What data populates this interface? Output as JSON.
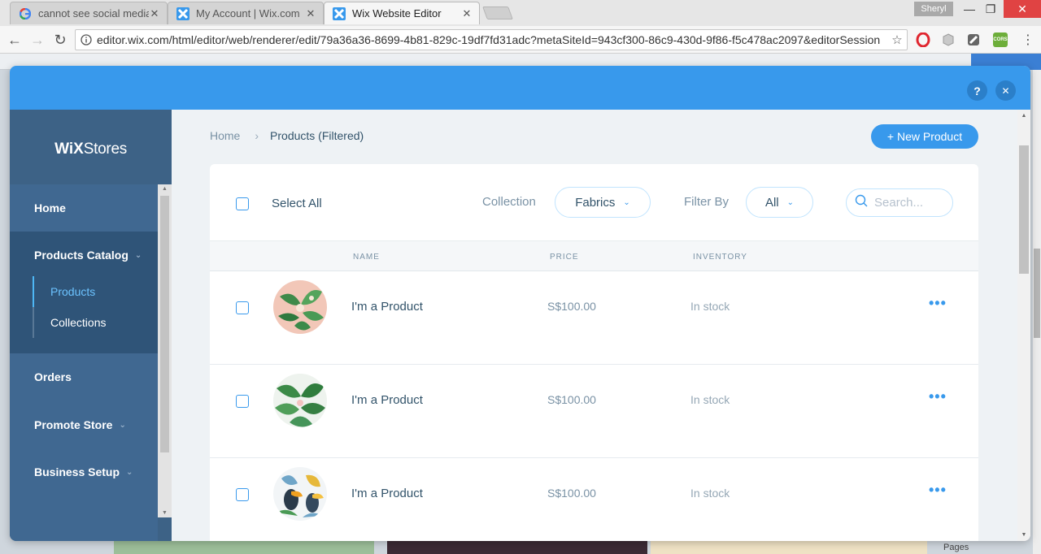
{
  "browser": {
    "tabs": [
      {
        "title": "cannot see social media",
        "favicon": "google-icon"
      },
      {
        "title": "My Account | Wix.com",
        "favicon": "wix-icon"
      },
      {
        "title": "Wix Website Editor",
        "favicon": "wix-icon",
        "active": true
      }
    ],
    "close_glyph": "✕",
    "profile_name": "Sheryl",
    "url": "editor.wix.com/html/editor/web/renderer/edit/79a36a36-8699-4b81-829c-19df7fd31adc?metaSiteId=943cf300-86c9-430d-9f86-f5c478ac2097&editorSession",
    "ext_cors_label": "CORS"
  },
  "modal": {
    "help_glyph": "?",
    "close_glyph": "✕"
  },
  "sidebar": {
    "logo_bold": "WiX",
    "logo_rest": "Stores",
    "items": [
      {
        "label": "Home"
      },
      {
        "label": "Products Catalog"
      },
      {
        "label": "Orders"
      },
      {
        "label": "Promote Store"
      },
      {
        "label": "Business Setup"
      }
    ],
    "sub_items": [
      {
        "label": "Products",
        "active": true
      },
      {
        "label": "Collections"
      }
    ]
  },
  "content": {
    "breadcrumb": {
      "home": "Home",
      "current": "Products (Filtered)"
    },
    "new_product_label": "+ New Product",
    "select_all_label": "Select All",
    "collection_label": "Collection",
    "collection_value": "Fabrics",
    "filter_label": "Filter By",
    "filter_value": "All",
    "search_placeholder": "Search...",
    "columns": [
      "NAME",
      "PRICE",
      "INVENTORY"
    ],
    "rows": [
      {
        "name": "I'm a Product",
        "price": "S$100.00",
        "inventory": "In stock",
        "image": "tropical-leaves-pink"
      },
      {
        "name": "I'm a Product",
        "price": "S$100.00",
        "inventory": "In stock",
        "image": "tropical-leaves-white"
      },
      {
        "name": "I'm a Product",
        "price": "S$100.00",
        "inventory": "In stock",
        "image": "toucan-pattern"
      }
    ],
    "more_glyph": "•••"
  },
  "colors": {
    "accent": "#3899ec",
    "sidebar": "#3d6286",
    "sidebar_active_block": "#2f5478",
    "active_link": "#6cc3ff",
    "text_dark": "#32536a",
    "text_muted": "#7a92a5"
  },
  "editor_bg": {
    "pages_label": "Pages"
  }
}
